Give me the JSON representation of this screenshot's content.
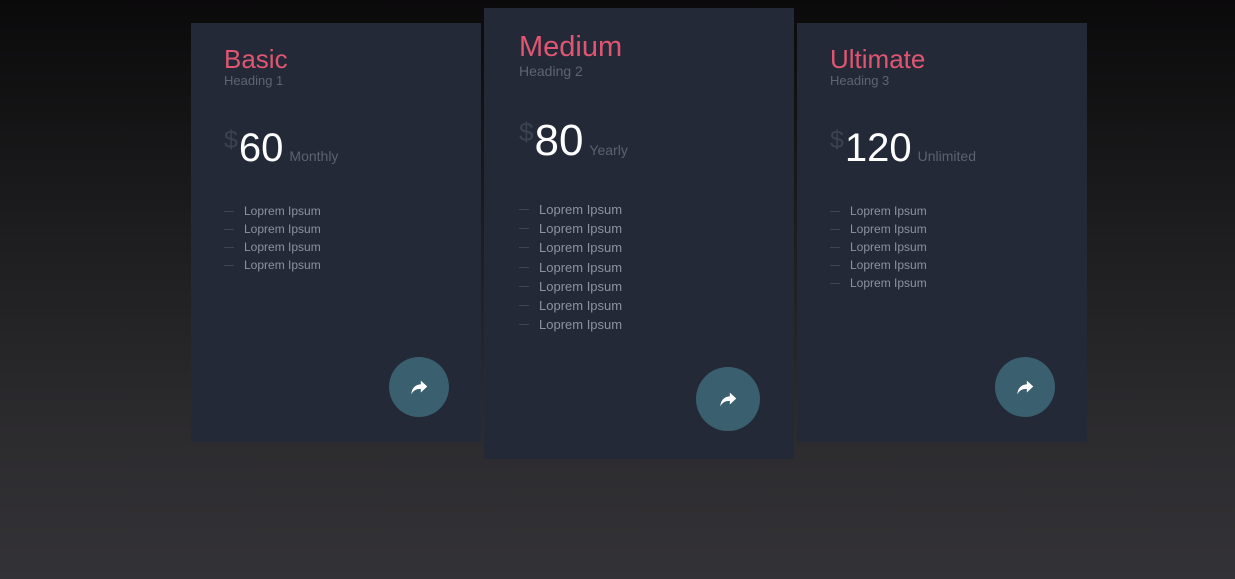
{
  "plans": [
    {
      "name": "Basic",
      "heading": "Heading 1",
      "currency": "$",
      "price": "60",
      "period": "Monthly",
      "features": [
        "Loprem Ipsum",
        "Loprem Ipsum",
        "Loprem Ipsum",
        "Loprem Ipsum"
      ],
      "button_icon": "share-arrow-icon"
    },
    {
      "name": "Medium",
      "heading": "Heading 2",
      "currency": "$",
      "price": "80",
      "period": "Yearly",
      "features": [
        "Loprem Ipsum",
        "Loprem Ipsum",
        "Loprem Ipsum",
        "Loprem Ipsum",
        "Loprem Ipsum",
        "Loprem Ipsum",
        "Loprem Ipsum"
      ],
      "button_icon": "share-arrow-icon"
    },
    {
      "name": "Ultimate",
      "heading": "Heading 3",
      "currency": "$",
      "price": "120",
      "period": "Unlimited",
      "features": [
        "Loprem Ipsum",
        "Loprem Ipsum",
        "Loprem Ipsum",
        "Loprem Ipsum",
        "Loprem Ipsum"
      ],
      "button_icon": "share-arrow-icon"
    }
  ],
  "colors": {
    "card_bg": "#232937",
    "plan_name": "#e05672",
    "button_bg": "#3a5f6f",
    "price": "#ffffff"
  }
}
